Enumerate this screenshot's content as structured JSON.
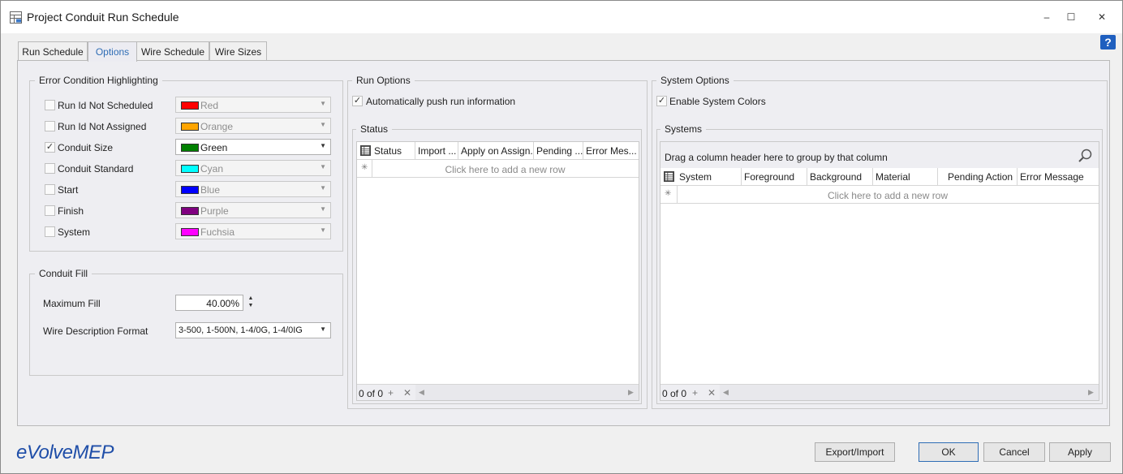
{
  "window": {
    "title": "Project Conduit Run Schedule",
    "help_label": "?"
  },
  "tabs": [
    {
      "label": "Run Schedule",
      "active": false
    },
    {
      "label": "Options",
      "active": true
    },
    {
      "label": "Wire Schedule",
      "active": false
    },
    {
      "label": "Wire Sizes",
      "active": false
    }
  ],
  "error_highlighting": {
    "title": "Error Condition Highlighting",
    "rows": [
      {
        "label": "Run Id Not Scheduled",
        "checked": false,
        "color_name": "Red",
        "color": "#ff0000"
      },
      {
        "label": "Run Id Not Assigned",
        "checked": false,
        "color_name": "Orange",
        "color": "#ffa500"
      },
      {
        "label": "Conduit Size",
        "checked": true,
        "color_name": "Green",
        "color": "#008000"
      },
      {
        "label": "Conduit Standard",
        "checked": false,
        "color_name": "Cyan",
        "color": "#00ffff"
      },
      {
        "label": "Start",
        "checked": false,
        "color_name": "Blue",
        "color": "#0000ff"
      },
      {
        "label": "Finish",
        "checked": false,
        "color_name": "Purple",
        "color": "#800080"
      },
      {
        "label": "System",
        "checked": false,
        "color_name": "Fuchsia",
        "color": "#ff00ff"
      }
    ]
  },
  "conduit_fill": {
    "title": "Conduit Fill",
    "max_fill_label": "Maximum Fill",
    "max_fill_value": "40.00%",
    "wire_format_label": "Wire Description Format",
    "wire_format_value": "3-500, 1-500N, 1-4/0G, 1-4/0IG"
  },
  "run_options": {
    "title": "Run Options",
    "auto_push_label": "Automatically push run information",
    "auto_push_checked": true,
    "status_title": "Status",
    "columns": [
      "Status",
      "Import ...",
      "Apply on Assign...",
      "Pending ...",
      "Error Mes..."
    ],
    "new_row_text": "Click here to add a new row",
    "nav_count": "0 of 0"
  },
  "system_options": {
    "title": "System Options",
    "enable_colors_label": "Enable System Colors",
    "enable_colors_checked": true,
    "systems_title": "Systems",
    "group_by_text": "Drag a column header here to group by that column",
    "columns": [
      "System",
      "Foreground",
      "Background",
      "Material",
      "Pending Action",
      "Error Message"
    ],
    "new_row_text": "Click here to add a new row",
    "nav_count": "0 of 0"
  },
  "buttons": {
    "export_import": "Export/Import",
    "ok": "OK",
    "cancel": "Cancel",
    "apply": "Apply"
  },
  "logo_text": "eVolveMEP",
  "icons": {
    "check": "✓",
    "dropdown": "▼",
    "minimize": "–",
    "maximize": "☐",
    "close": "✕",
    "star": "✳",
    "add": "+",
    "delete": "✕",
    "left": "◀",
    "right": "▶",
    "spin_up": "▲",
    "spin_down": "▼",
    "search": "⚲"
  }
}
